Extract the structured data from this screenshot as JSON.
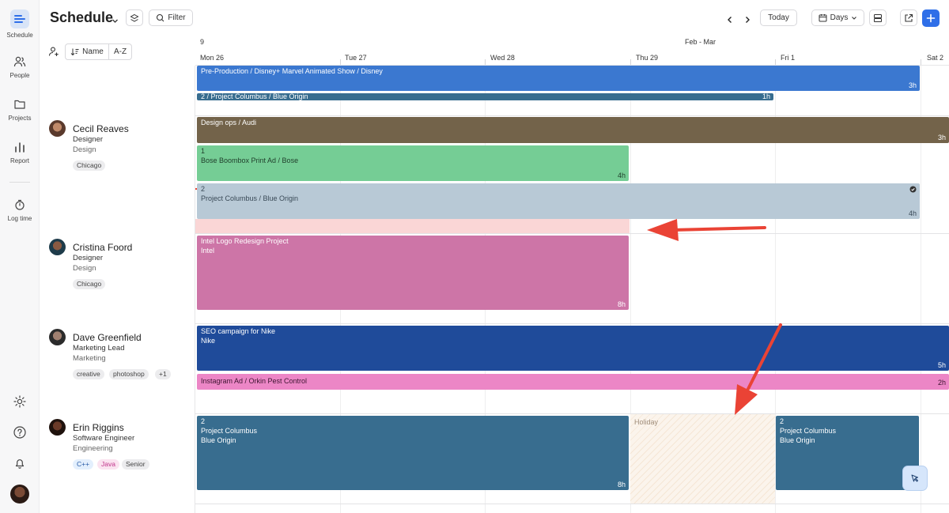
{
  "nav": {
    "items": [
      {
        "label": "Schedule",
        "icon": "schedule-icon"
      },
      {
        "label": "People",
        "icon": "people-icon"
      },
      {
        "label": "Projects",
        "icon": "folder-icon"
      },
      {
        "label": "Report",
        "icon": "bar-chart-icon"
      },
      {
        "label": "Log time",
        "icon": "stopwatch-icon"
      }
    ],
    "bottom_icons": [
      "gear-icon",
      "help-icon",
      "bell-icon",
      "avatar"
    ]
  },
  "header": {
    "title": "Schedule",
    "filter_label": "Filter",
    "today_label": "Today",
    "view_label": "Days"
  },
  "people_header": {
    "sort_label": "Name",
    "order_label": "A-Z"
  },
  "timeline": {
    "first_week_num": "9",
    "month_range": "Feb - Mar",
    "days": [
      "Mon 26",
      "Tue 27",
      "Wed 28",
      "Thu 29",
      "Fri 1",
      "Sat 2"
    ]
  },
  "people": [
    {
      "name": "Cecil Reaves",
      "role": "Designer",
      "dept": "Design",
      "tags": [
        "Chicago"
      ]
    },
    {
      "name": "Cristina Foord",
      "role": "Designer",
      "dept": "Design",
      "tags": [
        "Chicago"
      ]
    },
    {
      "name": "Dave Greenfield",
      "role": "Marketing Lead",
      "dept": "Marketing",
      "tags": [
        "creative",
        "photoshop",
        "+1"
      ]
    },
    {
      "name": "Erin Riggins",
      "role": "Software Engineer",
      "dept": "Engineering",
      "tags": [
        "C++",
        "Java",
        "Senior"
      ]
    }
  ],
  "events": [
    {
      "l1": "Pre-Production / Disney+ Marvel Animated Show / Disney",
      "l2": "",
      "l3": "",
      "hours": "3h",
      "color": "#3b78d0"
    },
    {
      "l1": "2 / Project Columbus / Blue Origin",
      "l2": "",
      "l3": "",
      "hours": "1h",
      "color": "#386d8f"
    },
    {
      "l1": "Design ops / Audi",
      "l2": "",
      "l3": "",
      "hours": "3h",
      "color": "#73634a"
    },
    {
      "l1": "1",
      "l2": "Bose Boombox Print Ad / Bose",
      "l3": "",
      "hours": "4h",
      "color": "#75cd95"
    },
    {
      "l1": "2",
      "l2": "Project Columbus / Blue Origin",
      "l3": "",
      "hours": "4h",
      "color": "#b8c9d6"
    },
    {
      "l1": "Intel Logo Redesign Project",
      "l2": "Intel",
      "l3": "",
      "hours": "8h",
      "color": "#cd75a7"
    },
    {
      "l1": "SEO campaign for Nike",
      "l2": "Nike",
      "l3": "",
      "hours": "5h",
      "color": "#1f4b9a"
    },
    {
      "l1": "Instagram Ad / Orkin Pest Control",
      "l2": "",
      "l3": "",
      "hours": "2h",
      "color": "#ec86c6"
    },
    {
      "l1": "2",
      "l2": "Project Columbus",
      "l3": "Blue Origin",
      "hours": "8h",
      "color": "#386d8f"
    },
    {
      "l1": "2",
      "l2": "Project Columbus",
      "l3": "Blue Origin",
      "hours": "",
      "color": "#386d8f"
    }
  ],
  "holiday_label": "Holiday",
  "colors": {
    "accent": "#2f6fe8",
    "holiday": "#faf3ea",
    "overtime": "#fad6d6",
    "arrow": "#ea4335"
  }
}
